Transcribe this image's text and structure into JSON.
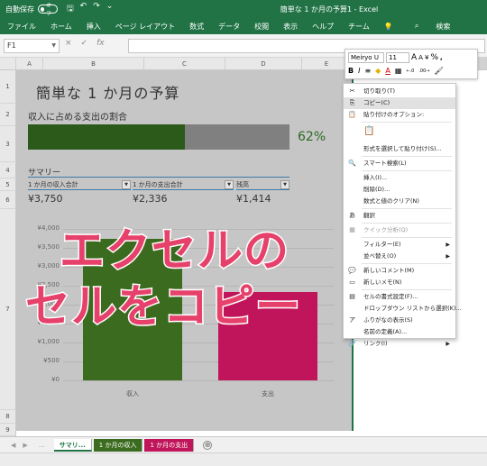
{
  "titlebar": {
    "autosave_label": "自動保存",
    "autosave_state": "オフ",
    "doc_title": "簡単な 1 か月の予算1 - Excel",
    "accent_color": "#217346"
  },
  "ribbon_tabs": [
    "ファイル",
    "ホーム",
    "挿入",
    "ページ レイアウト",
    "数式",
    "データ",
    "校閲",
    "表示",
    "ヘルプ",
    "チーム"
  ],
  "search_label": "検索",
  "formula_bar": {
    "name_box": "F1",
    "cancel": "×",
    "enter": "✓",
    "fx": "fx"
  },
  "columns": [
    "A",
    "B",
    "C",
    "D",
    "E"
  ],
  "rows": [
    "1",
    "2",
    "3",
    "4",
    "5",
    "6",
    "7",
    "8",
    "9"
  ],
  "sheet": {
    "title": "簡単な 1 か月の予算",
    "subtitle": "収入に占める支出の割合",
    "ratio": 0.62,
    "percent_label": "62%",
    "summary_label": "サマリー",
    "headers": [
      "1 か月の収入合計",
      "1 か月の支出合計",
      "残高"
    ],
    "values": [
      "¥3,750",
      "¥2,336",
      "¥1,414"
    ],
    "bar_dark": "#2b5a1b",
    "bar_light": "#808080"
  },
  "chart_data": {
    "type": "bar",
    "categories": [
      "収入",
      "支出"
    ],
    "values": [
      3750,
      2336
    ],
    "colors": [
      "#3b6b1e",
      "#c0155a"
    ],
    "ylim": [
      0,
      4000
    ],
    "yticks": [
      "¥4,000",
      "¥3,500",
      "¥3,000",
      "¥2,500",
      "¥2,000",
      "¥1,500",
      "¥1,000",
      "¥500",
      "¥0"
    ],
    "grid": true
  },
  "overlay": {
    "line1": "エクセルの",
    "line2": "セルをコピー",
    "color": "#e6416b"
  },
  "mini_toolbar": {
    "font": "Meiryo U",
    "size": "11",
    "grow": "A",
    "shrink": "A",
    "currency": "¥",
    "percent": "%",
    "comma": ",",
    "bold": "B",
    "italic": "I",
    "font_color_letter": "A",
    "dec_inc": "←.0",
    "dec_dec": ".00→"
  },
  "context_menu": {
    "items": [
      {
        "label": "切り取り(T)",
        "icon": "✂",
        "disabled": false,
        "highlight": false,
        "arrow": false
      },
      {
        "label": "コピー(C)",
        "icon": "⎘",
        "disabled": false,
        "highlight": true,
        "arrow": false
      },
      {
        "label": "貼り付けのオプション:",
        "icon": "📋",
        "disabled": false,
        "highlight": false,
        "arrow": false
      },
      {
        "label": "",
        "icon": "📋",
        "disabled": false,
        "highlight": false,
        "arrow": false
      },
      {
        "label": "形式を選択して貼り付け(S)...",
        "icon": "",
        "disabled": false,
        "highlight": false,
        "arrow": false
      },
      {
        "label": "スマート検索(L)",
        "icon": "🔍",
        "disabled": false,
        "highlight": false,
        "arrow": false
      },
      {
        "label": "挿入(I)...",
        "icon": "",
        "disabled": false,
        "highlight": false,
        "arrow": false
      },
      {
        "label": "削除(D)...",
        "icon": "",
        "disabled": false,
        "highlight": false,
        "arrow": false
      },
      {
        "label": "数式と値のクリア(N)",
        "icon": "",
        "disabled": false,
        "highlight": false,
        "arrow": false
      },
      {
        "label": "翻訳",
        "icon": "あ",
        "disabled": false,
        "highlight": false,
        "arrow": false
      },
      {
        "label": "クイック分析(Q)",
        "icon": "▦",
        "disabled": true,
        "highlight": false,
        "arrow": false
      },
      {
        "label": "フィルター(E)",
        "icon": "",
        "disabled": false,
        "highlight": false,
        "arrow": true
      },
      {
        "label": "並べ替え(O)",
        "icon": "",
        "disabled": false,
        "highlight": false,
        "arrow": true
      },
      {
        "label": "新しいコメント(M)",
        "icon": "💬",
        "disabled": false,
        "highlight": false,
        "arrow": false
      },
      {
        "label": "新しいメモ(N)",
        "icon": "▭",
        "disabled": false,
        "highlight": false,
        "arrow": false
      },
      {
        "label": "セルの書式設定(F)...",
        "icon": "▤",
        "disabled": false,
        "highlight": false,
        "arrow": false
      },
      {
        "label": "ドロップダウン リストから選択(K)...",
        "icon": "",
        "disabled": false,
        "highlight": false,
        "arrow": false
      },
      {
        "label": "ふりがなの表示(S)",
        "icon": "ア",
        "disabled": false,
        "highlight": false,
        "arrow": false
      },
      {
        "label": "名前の定義(A)...",
        "icon": "",
        "disabled": false,
        "highlight": false,
        "arrow": false
      },
      {
        "label": "リンク(I)",
        "icon": "🔗",
        "disabled": false,
        "highlight": false,
        "arrow": true
      }
    ]
  },
  "sheet_tabs": [
    {
      "label": "サマリ...",
      "color": "#ffffff",
      "active": true
    },
    {
      "label": "1 か月の収入",
      "color": "#3b6b1e",
      "active": false
    },
    {
      "label": "1 か月の支出",
      "color": "#c0155a",
      "active": false
    }
  ],
  "add_sheet": "⊕"
}
